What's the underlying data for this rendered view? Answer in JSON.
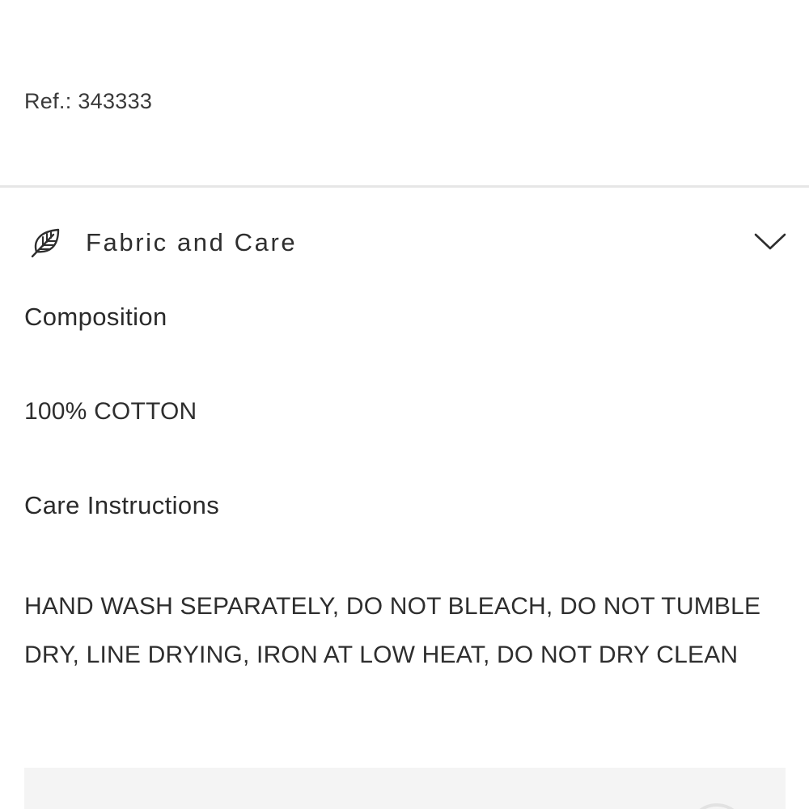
{
  "product": {
    "reference": "Ref.: 343333"
  },
  "accordion": {
    "title": "Fabric and Care",
    "icon": "leaf-icon",
    "toggle_icon": "chevron-down-icon"
  },
  "composition": {
    "heading": "Composition",
    "value": "100% COTTON"
  },
  "care": {
    "heading": "Care Instructions",
    "value": "HAND WASH SEPARATELY, DO NOT BLEACH, DO NOT TUMBLE DRY, LINE DRYING, IRON AT LOW HEAT, DO NOT DRY CLEAN"
  },
  "colors": {
    "text": "#2a2a2a",
    "divider": "#e6e6e6",
    "panel": "#f4f4f4"
  }
}
